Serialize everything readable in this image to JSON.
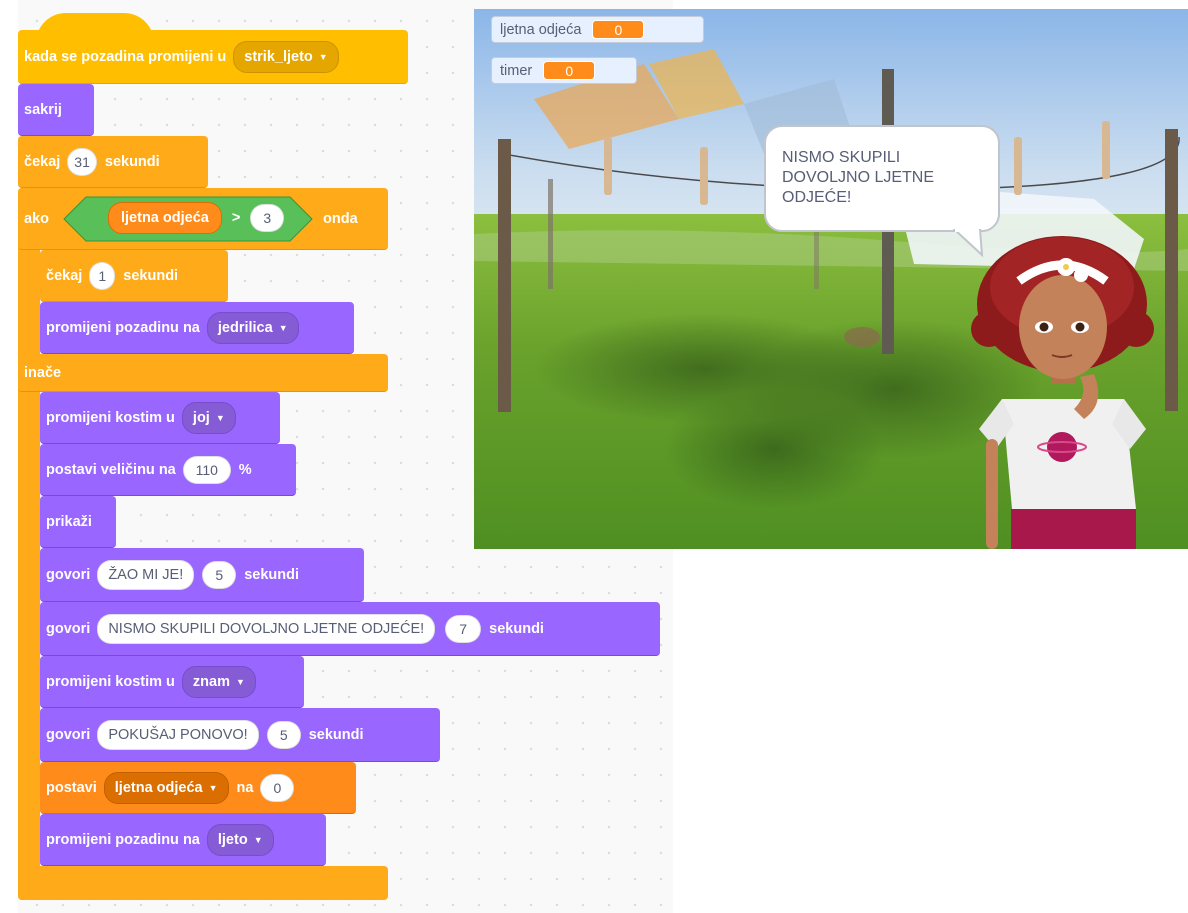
{
  "script": {
    "hat": {
      "label": "kada se pozadina promijeni u",
      "backdrop": "strik_ljeto"
    },
    "hide": "sakrij",
    "wait1": {
      "prefix": "čekaj",
      "value": "31",
      "suffix": "sekundi"
    },
    "if_block": {
      "prefix": "ako",
      "variable": "ljetna odjeća",
      "operator": ">",
      "value": "3",
      "suffix": "onda",
      "wait": {
        "prefix": "čekaj",
        "value": "1",
        "suffix": "sekundi"
      },
      "switch_backdrop": {
        "label": "promijeni pozadinu na",
        "value": "jedrilica"
      }
    },
    "else_label": "inače",
    "else": {
      "costume1": {
        "label": "promijeni kostim u",
        "value": "joj"
      },
      "size": {
        "label": "postavi veličinu na",
        "value": "110",
        "suffix": "%"
      },
      "show": "prikaži",
      "say1": {
        "prefix": "govori",
        "text": "ŽAO MI JE!",
        "seconds": "5",
        "suffix": "sekundi"
      },
      "say2": {
        "prefix": "govori",
        "text": "NISMO SKUPILI DOVOLJNO LJETNE ODJEĆE!",
        "seconds": "7",
        "suffix": "sekundi"
      },
      "costume2": {
        "label": "promijeni kostim u",
        "value": "znam"
      },
      "say3": {
        "prefix": "govori",
        "text": "POKUŠAJ PONOVO!",
        "seconds": "5",
        "suffix": "sekundi"
      },
      "setvar": {
        "label": "postavi",
        "variable": "ljetna odjeća",
        "to": "na",
        "value": "0"
      },
      "switch_backdrop": {
        "label": "promijeni pozadinu na",
        "value": "ljeto"
      }
    }
  },
  "stage": {
    "monitors": [
      {
        "label": "ljetna odjeća",
        "value": "0"
      },
      {
        "label": "timer",
        "value": "0"
      }
    ],
    "speech": [
      "NISMO SKUPILI",
      "DOVOLJNO LJETNE",
      "ODJEĆE!"
    ]
  },
  "colors": {
    "events": "#ffbf00",
    "control": "#ffab19",
    "looks": "#9966ff",
    "variables": "#ff8c1a",
    "operators": "#59c059",
    "monitor_bg": "#e6f0ff"
  }
}
